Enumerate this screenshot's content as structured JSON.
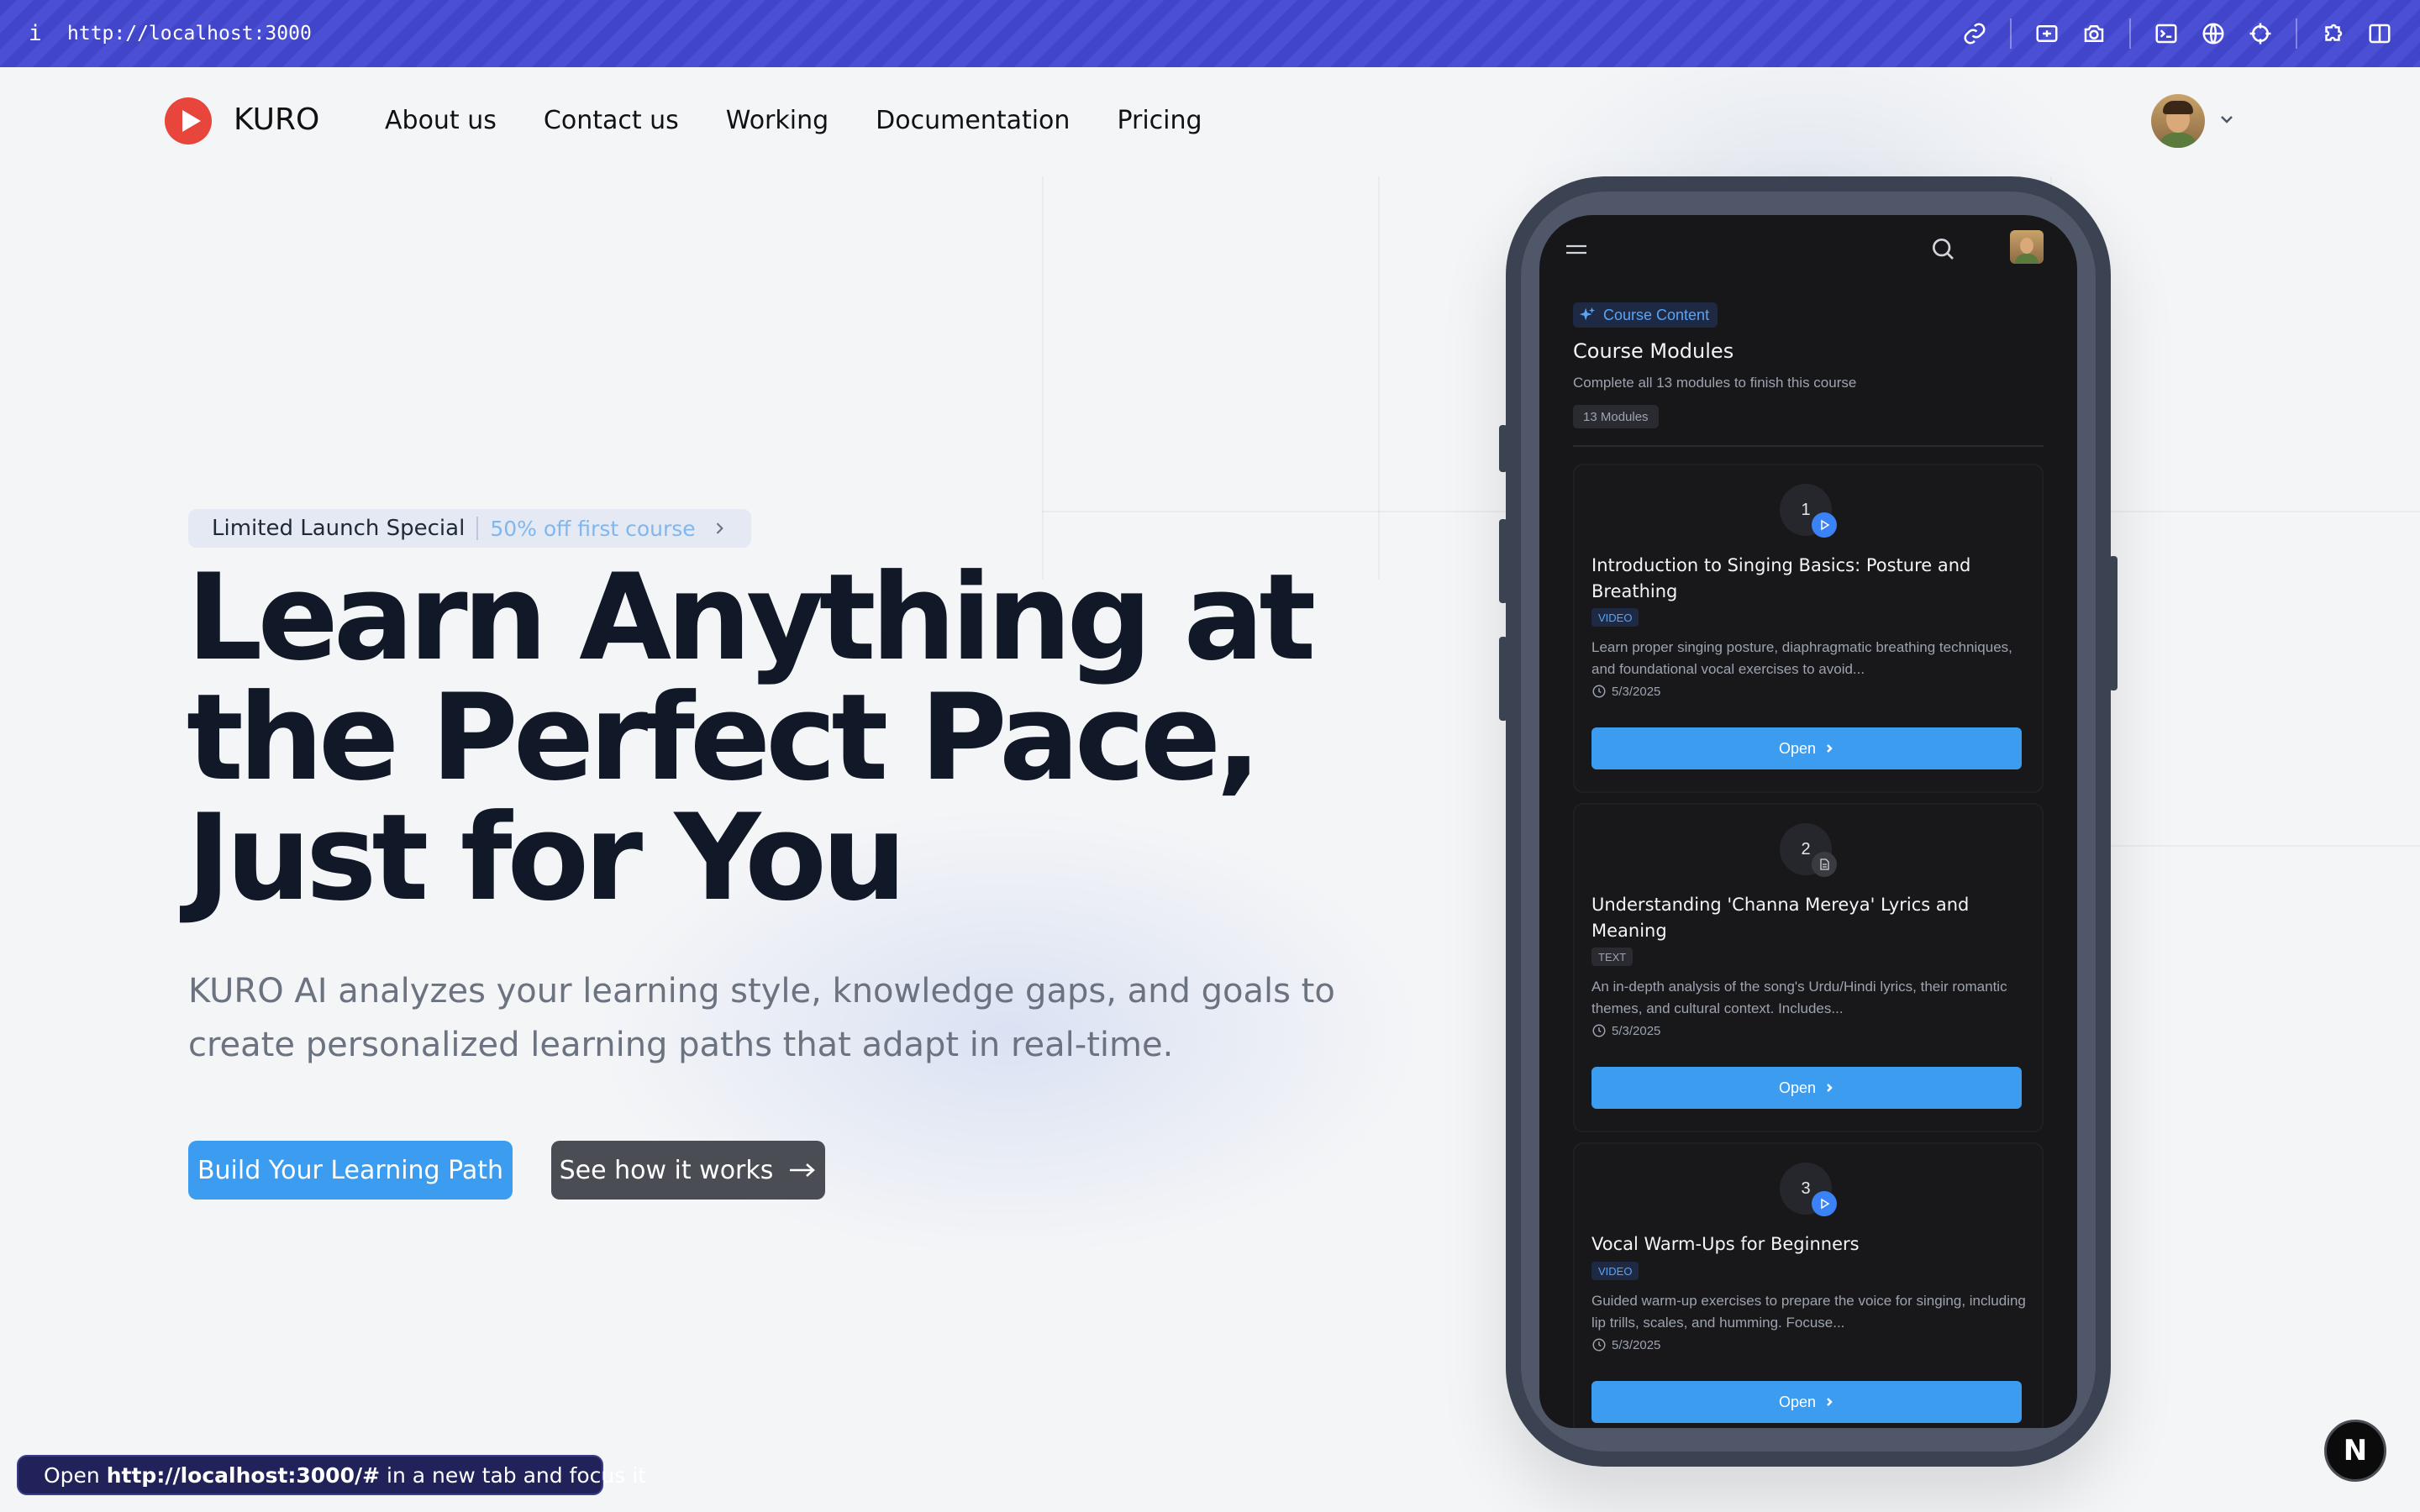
{
  "browser": {
    "info_icon": "info-icon",
    "url": "http://localhost:3000",
    "tools": [
      "link-icon",
      "screenshot-area-icon",
      "camera-icon",
      "terminal-icon",
      "globe-icon",
      "crosshair-icon",
      "extensions-icon",
      "sidebar-icon"
    ]
  },
  "nav": {
    "brand": "KURO",
    "links": [
      "About us",
      "Contact us",
      "Working",
      "Documentation",
      "Pricing"
    ]
  },
  "hero": {
    "promo_label": "Limited Launch Special",
    "promo_offer": "50% off first course",
    "headline": [
      "Learn Anything at",
      "the Perfect Pace,",
      "Just for You"
    ],
    "subtitle": "KURO AI analyzes your learning style, knowledge gaps, and goals to create personalized learning paths that adapt in real-time.",
    "primary_cta": "Build Your Learning Path",
    "secondary_cta": "See how it works"
  },
  "phone": {
    "badge": "Course Content",
    "title": "Course Modules",
    "subtitle": "Complete all 13 modules to finish this course",
    "count": "13 Modules",
    "modules": [
      {
        "number": "1",
        "title": "Introduction to Singing Basics: Posture and Breathing",
        "type": "VIDEO",
        "description": "Learn proper singing posture, diaphragmatic breathing techniques, and foundational vocal exercises to avoid...",
        "date": "5/3/2025",
        "button": "Open"
      },
      {
        "number": "2",
        "title": "Understanding 'Channa Mereya' Lyrics and Meaning",
        "type": "TEXT",
        "description": "An in-depth analysis of the song's Urdu/Hindi lyrics, their romantic themes, and cultural context. Includes...",
        "date": "5/3/2025",
        "button": "Open"
      },
      {
        "number": "3",
        "title": "Vocal Warm-Ups for Beginners",
        "type": "VIDEO",
        "description": "Guided warm-up exercises to prepare the voice for singing, including lip trills, scales, and humming. Focuse...",
        "date": "5/3/2025",
        "button": "Open"
      }
    ]
  },
  "status_toast": {
    "prefix": "Open",
    "url": "http://localhost:3000/#",
    "suffix": "in a new tab and focus it"
  },
  "nextjs_badge": "N",
  "colors": {
    "topbar": "#4145c9",
    "primary": "#3b9cf0",
    "logo": "#e8453c",
    "phone_frame": "#3b4251"
  }
}
